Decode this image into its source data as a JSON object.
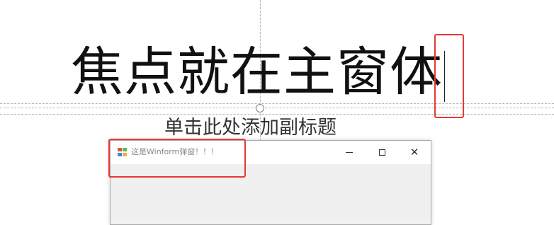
{
  "slide": {
    "title": "焦点就在主窗体",
    "subtitle": "单击此处添加副标题"
  },
  "winform": {
    "title": "这是Winform弹窗！！！",
    "controls": {
      "minimize": "minimize-icon",
      "maximize": "maximize-icon",
      "close": "close-icon",
      "close_glyph": "✕"
    }
  },
  "colors": {
    "highlight": "#e53935",
    "window_client": "#f0f0f0",
    "title_text": "#8a8a8a"
  }
}
